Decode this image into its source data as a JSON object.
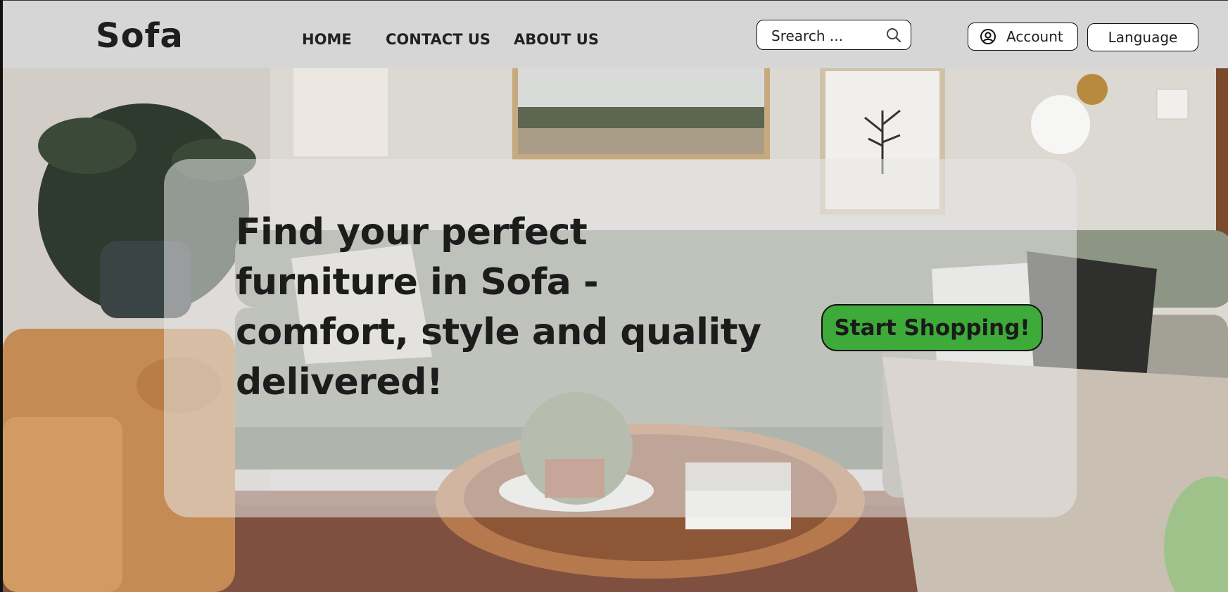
{
  "brand": {
    "logo_text": "Sofa"
  },
  "nav": {
    "home": "HOME",
    "contact": "CONTACT US",
    "about": "ABOUT US"
  },
  "search": {
    "placeholder": "Srearch ..."
  },
  "account": {
    "label": "Account",
    "icon": "user-circle-icon"
  },
  "language": {
    "label": "Language"
  },
  "hero": {
    "headline": "Find your perfect furniture in Sofa - comfort, style and quality delivered!",
    "cta_label": "Start Shopping!"
  },
  "colors": {
    "header_bg": "#d6d6d6",
    "cta_green": "#3daa3a",
    "text_dark": "#1c1c1c"
  }
}
